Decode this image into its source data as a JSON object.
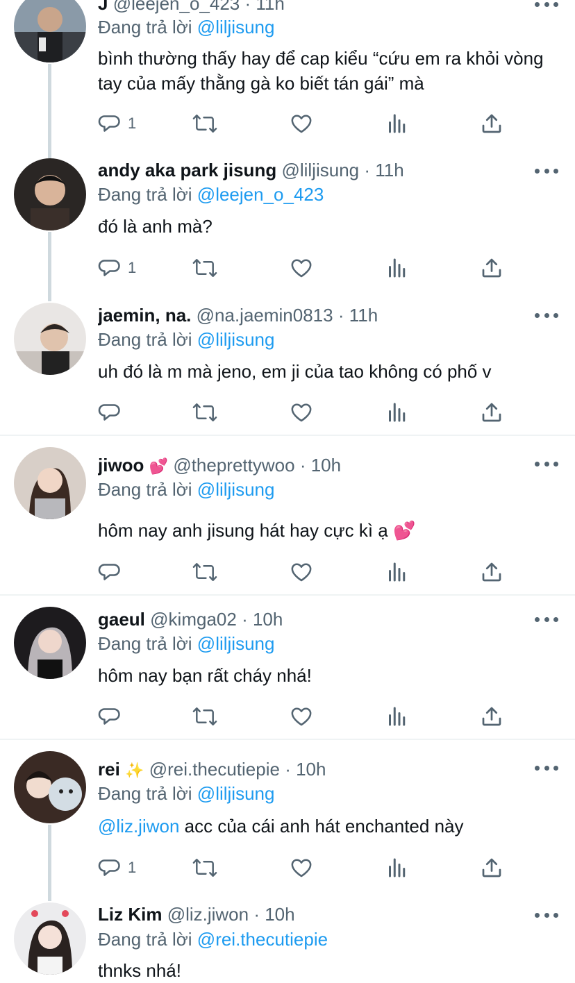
{
  "reply_prefix": "Đang trả lời",
  "colors": {
    "accent": "#1d9bf0",
    "muted": "#536471",
    "text": "#0f1419",
    "thread": "#cfd9de",
    "separator": "#eff3f4"
  },
  "icons": {
    "reply": "reply-bubble-icon",
    "retweet": "retweet-icon",
    "like": "heart-icon",
    "views": "bar-chart-icon",
    "share": "share-upload-icon",
    "more": "more-dots-icon"
  },
  "tweets": [
    {
      "name": "J",
      "handle": "@leejen_o_423",
      "time": "· 11h",
      "reply_to": "@liljisung",
      "text": "bình thường thấy hay để cap kiểu “cứu em ra khỏi vòng tay của mấy thằng gà ko biết tán gái” mà",
      "reply_count": "1"
    },
    {
      "name": "andy aka park jisung",
      "handle": "@liljisung",
      "time": "· 11h",
      "reply_to": "@leejen_o_423",
      "text": "đó là anh mà?",
      "reply_count": "1"
    },
    {
      "name": "jaemin, na.",
      "handle": "@na.jaemin0813",
      "time": "· 11h",
      "reply_to": "@liljisung",
      "text": "uh đó là m mà jeno, em ji của tao không có phố v",
      "reply_count": ""
    },
    {
      "name": "jiwoo",
      "name_emoji": "💕",
      "handle": "@theprettywoo",
      "time": "· 10h",
      "reply_to": "@liljisung",
      "text": "hôm nay anh jisung hát hay cực kì ạ 💕",
      "reply_count": ""
    },
    {
      "name": "gaeul",
      "handle": "@kimga02",
      "time": "· 10h",
      "reply_to": "@liljisung",
      "text": "hôm nay bạn rất cháy nhá!",
      "reply_count": ""
    },
    {
      "name": "rei",
      "name_emoji": "✨",
      "handle": "@rei.thecutiepie",
      "time": "· 10h",
      "reply_to": "@liljisung",
      "text_mention": "@liz.jiwon",
      "text": " acc của cái anh hát enchanted này",
      "reply_count": "1"
    },
    {
      "name": "Liz Kim",
      "handle": "@liz.jiwon",
      "time": "· 10h",
      "reply_to": "@rei.thecutiepie",
      "text": "thnks nhá!",
      "reply_count": ""
    }
  ]
}
